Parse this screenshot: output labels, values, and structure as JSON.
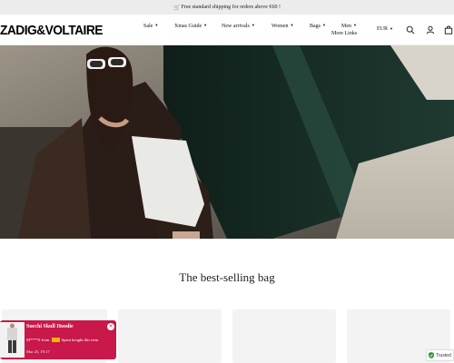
{
  "announcement": {
    "icon": "cart-icon",
    "text": "Free standard shipping for orders above €60 !"
  },
  "header": {
    "logo": "ZADIG&VOLTAIRE",
    "nav": [
      {
        "label": "Sale"
      },
      {
        "label": "Xmas Guide"
      },
      {
        "label": "New arrivals"
      },
      {
        "label": "Women"
      },
      {
        "label": "Bags"
      },
      {
        "label": "Men"
      }
    ],
    "more_links": "More Links",
    "currency": "EUR",
    "icons": [
      "search-icon",
      "account-icon",
      "bag-icon"
    ]
  },
  "hero": {
    "image": "hero-photo"
  },
  "section": {
    "title": "The best-selling bag"
  },
  "toast": {
    "product_name": "Suechi Skull Hoodie",
    "message_prefix": "M****S from",
    "message_suffix": "Spain bought this item",
    "date": "Mar 25, 19:17",
    "close": "×"
  },
  "badge": {
    "label": "Trusted"
  },
  "colors": {
    "toast_bg": "#c9184a",
    "announcement_bg": "#ececec"
  }
}
